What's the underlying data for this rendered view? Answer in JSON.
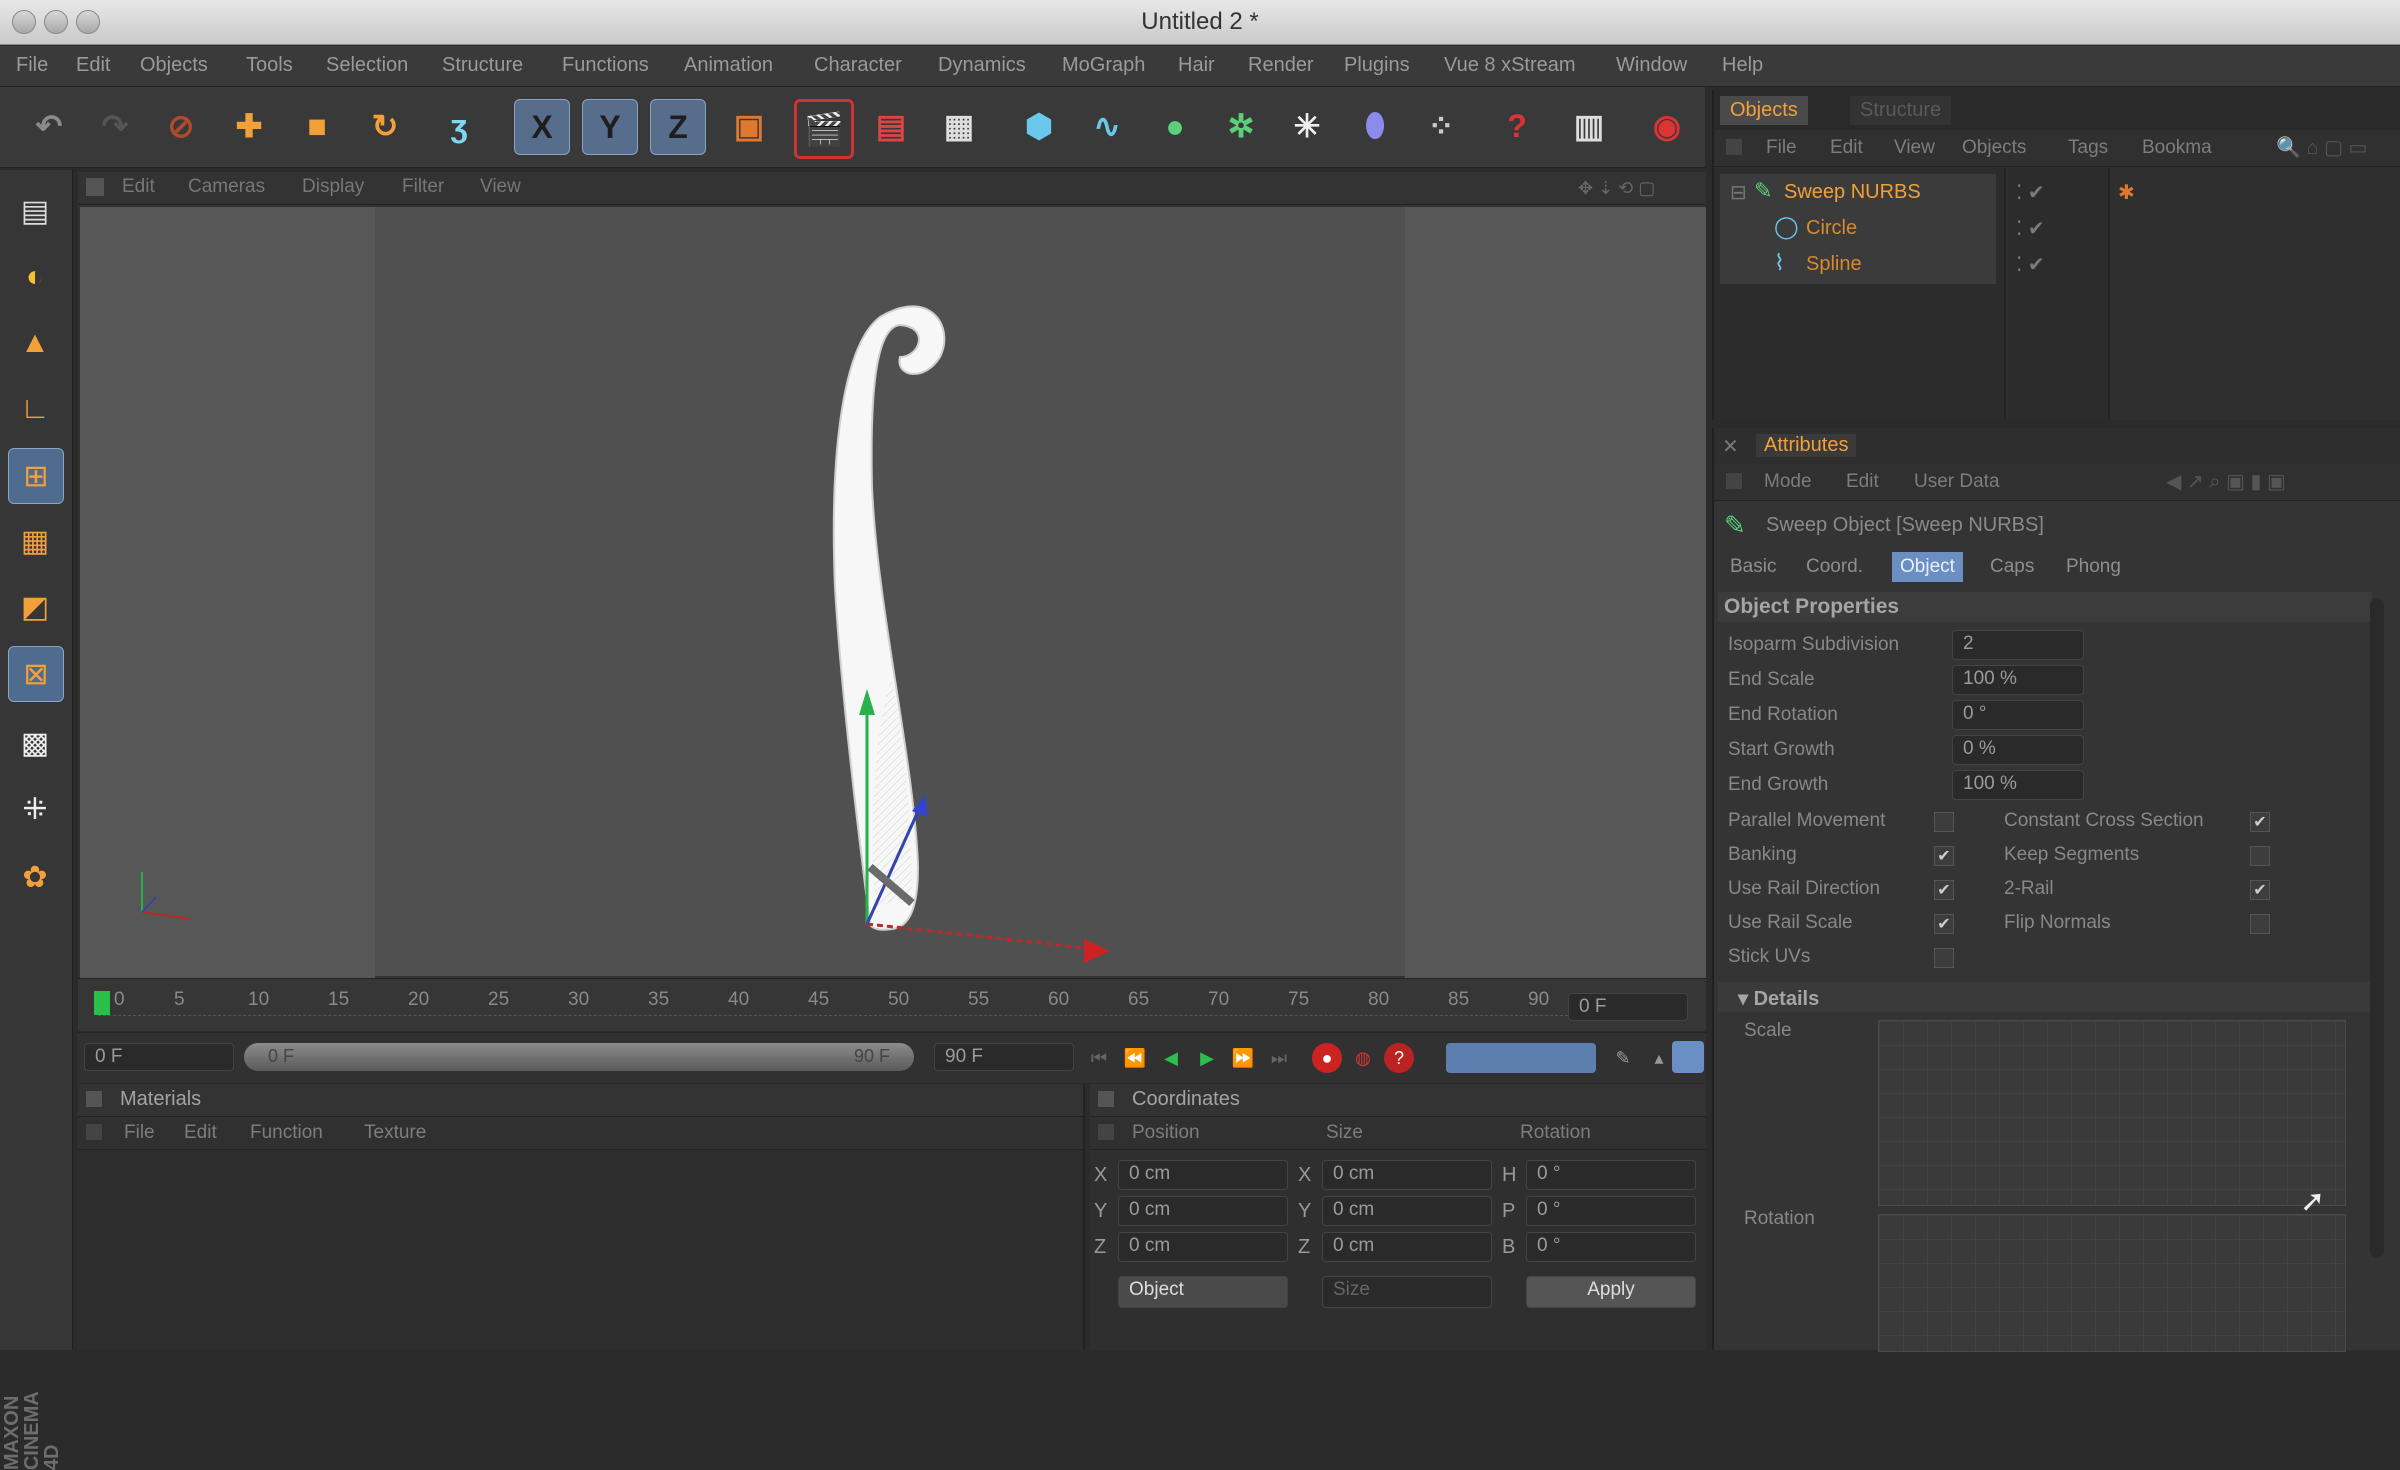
{
  "window": {
    "title": "Untitled 2 *"
  },
  "menu": [
    "File",
    "Edit",
    "Objects",
    "Tools",
    "Selection",
    "Structure",
    "Functions",
    "Animation",
    "Character",
    "Dynamics",
    "MoGraph",
    "Hair",
    "Render",
    "Plugins",
    "Vue 8 xStream",
    "Window",
    "Help"
  ],
  "toolbar": {
    "icons": [
      "undo-icon",
      "redo-icon",
      "live-select-icon",
      "move-icon",
      "scale-icon",
      "rotate-icon",
      "recent-tool-icon",
      "x-axis-icon",
      "y-axis-icon",
      "z-axis-icon",
      "coordinate-system-icon",
      "render-view-icon",
      "render-picture-viewer-icon",
      "render-settings-icon",
      "cube-icon",
      "spline-pen-icon",
      "nurbs-icon",
      "array-icon",
      "scene-icon",
      "deformer-icon",
      "particle-icon",
      "help-icon",
      "timeline-icon",
      "record-icon"
    ],
    "x": "X",
    "y": "Y",
    "z": "Z"
  },
  "viewport": {
    "menu": [
      "Edit",
      "Cameras",
      "Display",
      "Filter",
      "View"
    ]
  },
  "timeline": {
    "ticks": [
      "0",
      "5",
      "10",
      "15",
      "20",
      "25",
      "30",
      "35",
      "40",
      "45",
      "50",
      "55",
      "60",
      "65",
      "70",
      "75",
      "80",
      "85",
      "90"
    ],
    "current_frame": "0 F",
    "start": "0 F",
    "range_start": "0 F",
    "range_end": "90 F",
    "end": "90 F"
  },
  "materials": {
    "title": "Materials",
    "menu": [
      "File",
      "Edit",
      "Function",
      "Texture"
    ]
  },
  "coordinates": {
    "title": "Coordinates",
    "columns": [
      "Position",
      "Size",
      "Rotation"
    ],
    "rows": [
      {
        "axis": "X",
        "pos": "0 cm",
        "saxis": "X",
        "size": "0 cm",
        "raxis": "H",
        "rot": "0 °"
      },
      {
        "axis": "Y",
        "pos": "0 cm",
        "saxis": "Y",
        "size": "0 cm",
        "raxis": "P",
        "rot": "0 °"
      },
      {
        "axis": "Z",
        "pos": "0 cm",
        "saxis": "Z",
        "size": "0 cm",
        "raxis": "B",
        "rot": "0 °"
      }
    ],
    "mode": "Object",
    "size_mode": "Size",
    "apply": "Apply"
  },
  "objects": {
    "tabs": [
      "Objects",
      "Structure"
    ],
    "menu": [
      "File",
      "Edit",
      "View",
      "Objects",
      "Tags",
      "Bookma"
    ],
    "items": [
      {
        "name": "Sweep NURBS",
        "color": "#f3a03a"
      },
      {
        "name": "Circle",
        "color": "#d88a2e"
      },
      {
        "name": "Spline",
        "color": "#d88a2e"
      }
    ]
  },
  "attributes": {
    "title": "Attributes",
    "menu": [
      "Mode",
      "Edit",
      "User Data"
    ],
    "object_title": "Sweep Object [Sweep NURBS]",
    "tabs": [
      "Basic",
      "Coord.",
      "Object",
      "Caps",
      "Phong"
    ],
    "active_tab": "Object",
    "section": "Object Properties",
    "fields": [
      {
        "label": "Isoparm Subdivision",
        "value": "2"
      },
      {
        "label": "End Scale",
        "value": "100 %"
      },
      {
        "label": "End Rotation",
        "value": "0 °"
      },
      {
        "label": "Start Growth",
        "value": "0 %"
      },
      {
        "label": "End Growth",
        "value": "100 %"
      }
    ],
    "checks_left": [
      {
        "label": "Parallel Movement",
        "checked": false
      },
      {
        "label": "Banking",
        "checked": true
      },
      {
        "label": "Use Rail Direction",
        "checked": true
      },
      {
        "label": "Use Rail Scale",
        "checked": true
      },
      {
        "label": "Stick UVs",
        "checked": false
      }
    ],
    "checks_right": [
      {
        "label": "Constant Cross Section",
        "checked": true
      },
      {
        "label": "Keep Segments",
        "checked": false
      },
      {
        "label": "2-Rail",
        "checked": true
      },
      {
        "label": "Flip Normals",
        "checked": false
      }
    ],
    "details": "Details",
    "scale_label": "Scale",
    "rotation_label": "Rotation"
  },
  "brand": "MAXON CINEMA 4D",
  "colors": {
    "accent": "#f3a03a",
    "selection": "#6b8fc3",
    "record": "#cc3333"
  }
}
